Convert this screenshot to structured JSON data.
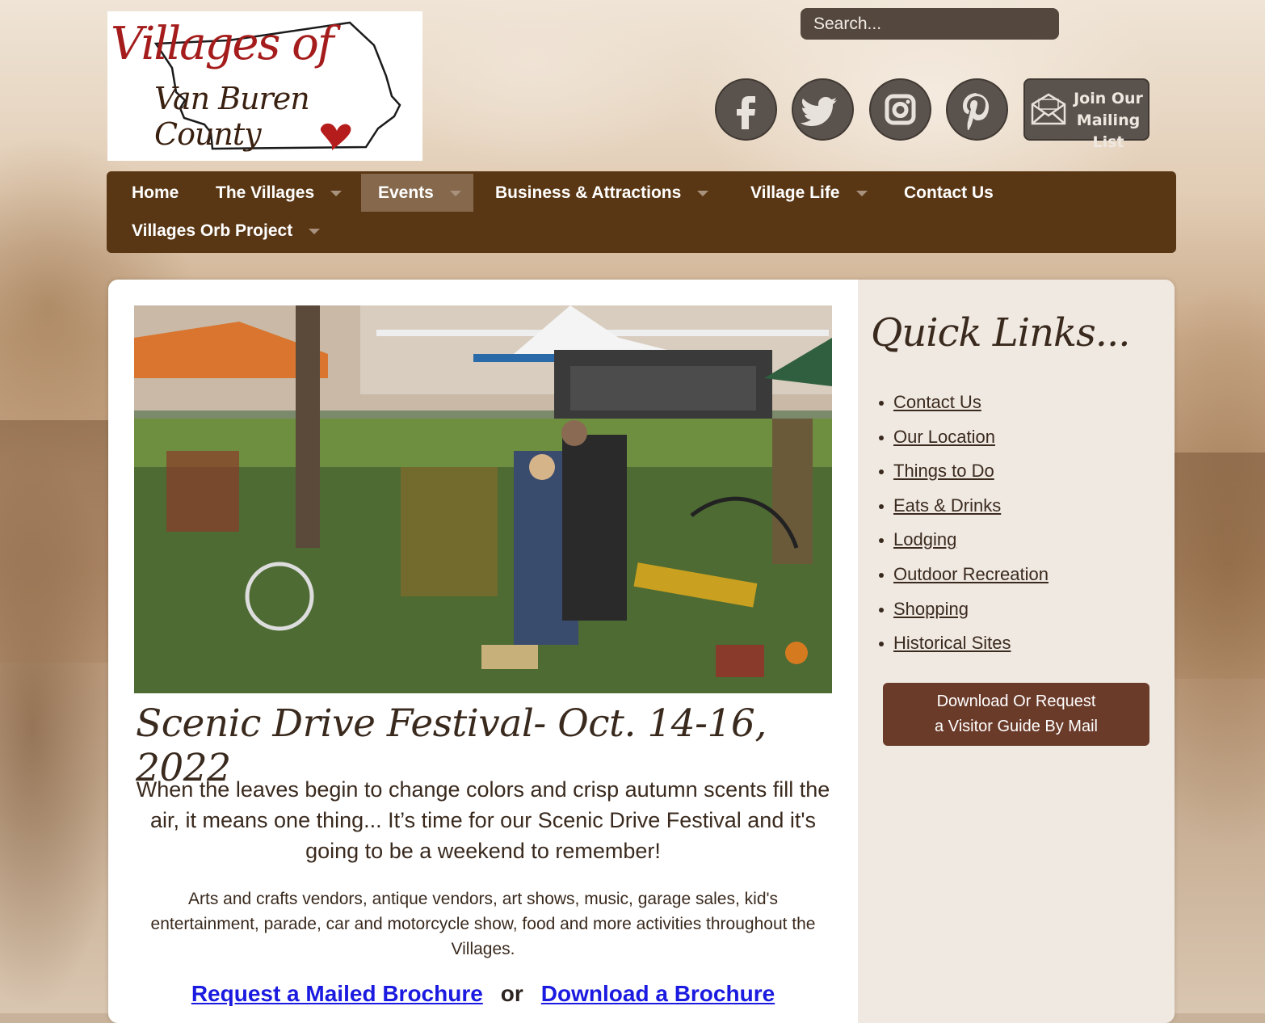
{
  "logo": {
    "line1": "Villages of",
    "line2": "Van Buren County"
  },
  "search": {
    "placeholder": "Search..."
  },
  "social": {
    "icons": [
      "facebook-icon",
      "twitter-icon",
      "instagram-icon",
      "pinterest-icon"
    ],
    "mailing_list_label": "Join Our Mailing List"
  },
  "nav": {
    "items": [
      {
        "label": "Home",
        "dropdown": false
      },
      {
        "label": "The Villages",
        "dropdown": true
      },
      {
        "label": "Events",
        "dropdown": true,
        "active": true
      },
      {
        "label": "Business & Attractions",
        "dropdown": true
      },
      {
        "label": "Village Life",
        "dropdown": true
      },
      {
        "label": "Contact Us",
        "dropdown": false
      },
      {
        "label": "Villages Orb Project",
        "dropdown": true
      }
    ]
  },
  "main": {
    "title": "Scenic Drive Festival- Oct. 14-16, 2022",
    "lead": "When the leaves begin to change colors and crisp autumn scents fill the air, it means one thing... It’s time for our Scenic Drive Festival and it's going to be a weekend to remember!",
    "body": "Arts and crafts vendors, antique vendors, art shows, music, garage sales, kid's entertainment, parade, car and motorcycle show, food and more activities throughout the Villages.",
    "link_request": "Request a Mailed Brochure",
    "link_or": "or",
    "link_download": "Download a Brochure"
  },
  "sidebar": {
    "title": "Quick Links...",
    "links": [
      "Contact Us",
      "Our Location",
      "Things to Do",
      "Eats & Drinks",
      "Lodging",
      "Outdoor Recreation",
      "Shopping",
      "Historical Sites"
    ],
    "guide_button_line1": "Download Or Request",
    "guide_button_line2": "a Visitor Guide By Mail"
  },
  "colors": {
    "nav_bg": "#5a3714",
    "nav_active": "#86694d",
    "guide_button": "#6b3b2a",
    "link_blue": "#1a1ae0",
    "logo_red": "#a51c1c"
  }
}
